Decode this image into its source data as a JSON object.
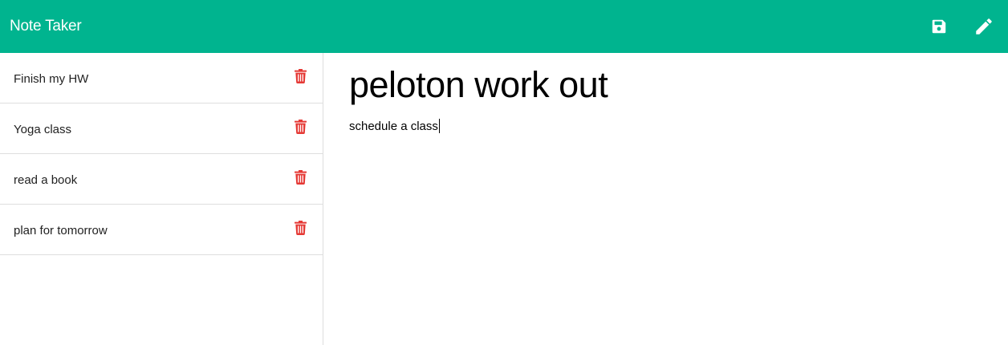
{
  "app": {
    "title": "Note Taker",
    "accent_color": "#00b48f",
    "delete_color": "#e53935"
  },
  "toolbar": {
    "save_icon": "save-icon",
    "new_note_icon": "pencil-icon"
  },
  "notes": [
    {
      "title": "Finish my HW",
      "delete_icon": "trash-icon"
    },
    {
      "title": "Yoga class",
      "delete_icon": "trash-icon"
    },
    {
      "title": "read a book",
      "delete_icon": "trash-icon"
    },
    {
      "title": "plan for tomorrow",
      "delete_icon": "trash-icon"
    }
  ],
  "editor": {
    "title_value": "peloton work out",
    "body_value": "schedule a class"
  }
}
